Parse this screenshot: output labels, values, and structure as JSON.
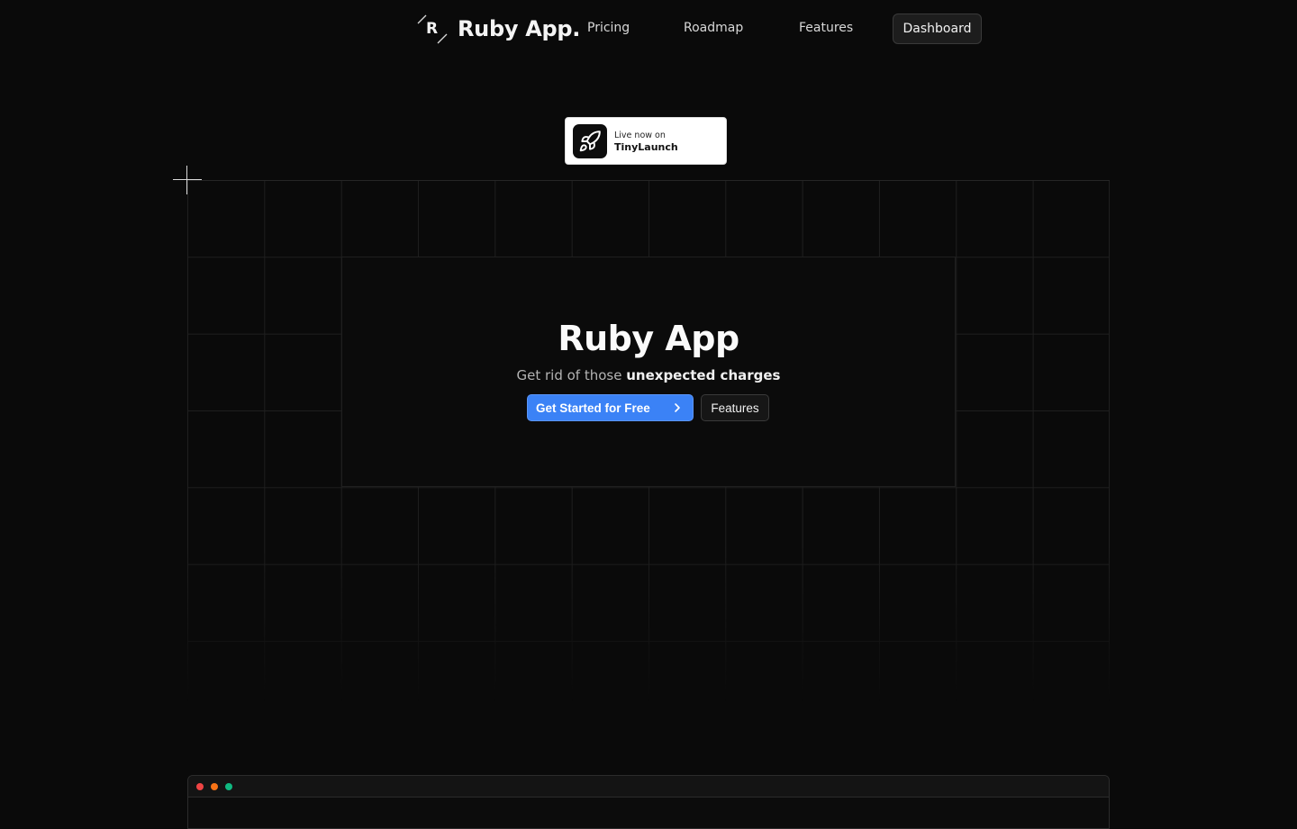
{
  "brand": {
    "name": "Ruby App.",
    "mark_letter": "R"
  },
  "nav": {
    "pricing": "Pricing",
    "roadmap": "Roadmap",
    "features": "Features",
    "dashboard": "Dashboard"
  },
  "badge": {
    "line1": "Live now on",
    "line2": "TinyLaunch"
  },
  "hero": {
    "title": "Ruby App",
    "subtitle_plain": "Get rid of those ",
    "subtitle_strong": "unexpected charges",
    "cta_primary": "Get Started for Free",
    "cta_secondary": "Features"
  },
  "colors": {
    "background": "#0a0a0a",
    "accent": "#3b82f6",
    "dot_red": "#ef4444",
    "dot_orange": "#f97316",
    "dot_green": "#10b981"
  },
  "icons": {
    "badge": "rocket-icon",
    "cta": "chevron-right-icon"
  }
}
